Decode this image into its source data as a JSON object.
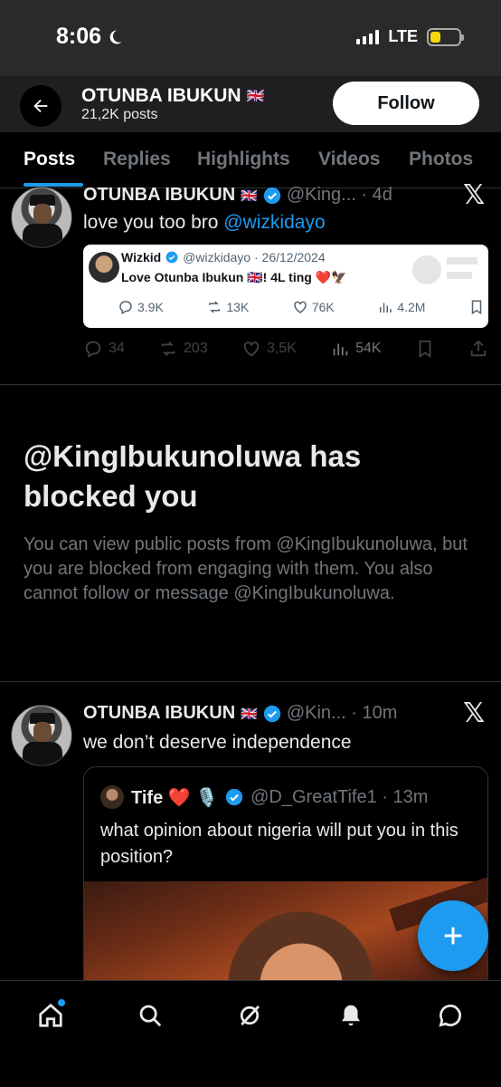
{
  "status_bar": {
    "time": "8:06",
    "network": "LTE"
  },
  "header": {
    "name": "OTUNBA IBUKUN",
    "flag": "🇬🇧",
    "posts_count": "21,2K posts",
    "follow_label": "Follow"
  },
  "tabs": [
    {
      "label": "Posts",
      "active": true
    },
    {
      "label": "Replies",
      "active": false
    },
    {
      "label": "Highlights",
      "active": false
    },
    {
      "label": "Videos",
      "active": false
    },
    {
      "label": "Photos",
      "active": false
    }
  ],
  "post1": {
    "name": "OTUNBA IBUKUN",
    "flag": "🇬🇧",
    "handle_time": "@King... · 4d",
    "text_prefix": "love you too bro ",
    "mention": "@wizkidayo",
    "embed": {
      "name": "Wizkid",
      "handle_date": "@wizkidayo · 26/12/2024",
      "text": "Love Otunba Ibukun 🇬🇧! 4L ting ❤️🦅",
      "replies": "3.9K",
      "reposts": "13K",
      "likes": "76K",
      "views": "4.2M"
    },
    "stats": {
      "replies": "34",
      "reposts": "203",
      "likes": "3,5K",
      "views": "54K"
    }
  },
  "blocked": {
    "title": "@KingIbukunoluwa has blocked you",
    "description": "You can view public posts from @KingIbukunoluwa, but you are blocked from engaging with them. You also cannot follow or message @KingIbukunoluwa."
  },
  "post2": {
    "name": "OTUNBA IBUKUN",
    "flag": "🇬🇧",
    "handle_time": "@Kin... · 10m",
    "text": "we don’t deserve independence",
    "quote": {
      "name": "Tife ❤️ 🎙️",
      "handle_time": "@D_GreatTife1 · 13m",
      "text": "what opinion about nigeria will put you in this position?"
    }
  },
  "colors": {
    "accent": "#1d9bf0",
    "background": "#000000",
    "muted": "#71767b"
  },
  "icons": [
    "back-arrow-icon",
    "verified-icon",
    "x-logo-icon",
    "reply-icon",
    "repost-icon",
    "like-icon",
    "views-icon",
    "bookmark-icon",
    "share-icon",
    "compose-icon",
    "home-icon",
    "search-icon",
    "grok-icon",
    "bell-icon",
    "messages-icon"
  ]
}
